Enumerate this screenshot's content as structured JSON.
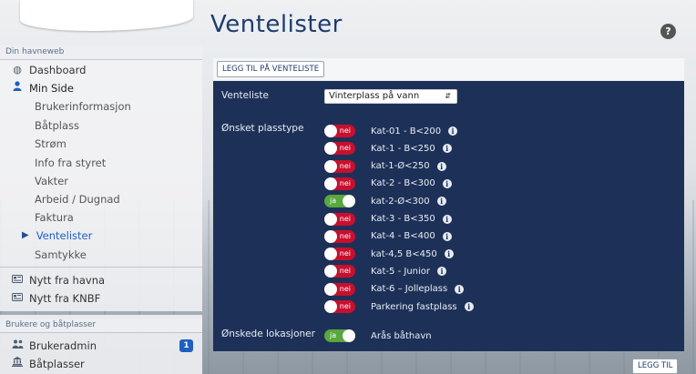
{
  "sidebar": {
    "section1_title": "Din havneweb",
    "items": [
      {
        "label": "Dashboard",
        "icon": "dashboard-icon"
      },
      {
        "label": "Min Side",
        "icon": "user-icon"
      },
      {
        "label": "Brukerinformasjon"
      },
      {
        "label": "Båtplass"
      },
      {
        "label": "Strøm"
      },
      {
        "label": "Info fra styret"
      },
      {
        "label": "Vakter"
      },
      {
        "label": "Arbeid / Dugnad"
      },
      {
        "label": "Faktura"
      },
      {
        "label": "Ventelister",
        "current": true
      },
      {
        "label": "Samtykke"
      },
      {
        "label": "Nytt fra havna",
        "icon": "newspaper-icon"
      },
      {
        "label": "Nytt fra KNBF",
        "icon": "newspaper-icon"
      }
    ],
    "section2_title": "Brukere og båtplasser",
    "items2": [
      {
        "label": "Brukeradmin",
        "icon": "users-icon",
        "badge": "1"
      },
      {
        "label": "Båtplasser",
        "icon": "harbor-icon"
      }
    ]
  },
  "main": {
    "title": "Ventelister",
    "add_button": "LEGG TIL PÅ VENTELISTE",
    "venteliste_label": "Venteliste",
    "venteliste_value": "Vinterplass på vann",
    "plasstype_label": "Ønsket plasstype",
    "plasstyper": [
      {
        "name": "Kat-01 - B<200",
        "state": "nei",
        "info": true
      },
      {
        "name": "Kat-1 - B<250",
        "state": "nei",
        "info": true
      },
      {
        "name": "kat-1-Ø<250",
        "state": "nei",
        "info": true
      },
      {
        "name": "Kat-2 - B<300",
        "state": "nei",
        "info": true
      },
      {
        "name": "kat-2-Ø<300",
        "state": "ja",
        "info": true
      },
      {
        "name": "Kat-3 - B<350",
        "state": "nei",
        "info": true
      },
      {
        "name": "Kat-4 - B<400",
        "state": "nei",
        "info": true
      },
      {
        "name": "kat-4,5 B<450",
        "state": "nei",
        "info": true
      },
      {
        "name": "Kat-5 - Junior",
        "state": "nei",
        "info": true
      },
      {
        "name": "Kat-6 – Jolleplass",
        "state": "nei",
        "info": true
      },
      {
        "name": "Parkering fastplass",
        "state": "nei",
        "info": true
      }
    ],
    "lokasjoner_label": "Ønskede lokasjoner",
    "lokasjoner": [
      {
        "name": "Arås båthavn",
        "state": "ja"
      }
    ],
    "bottom_button": "LEGG TIL",
    "info_glyph": "i",
    "help_glyph": "?"
  },
  "colors": {
    "panel": "#1d3158",
    "toggle_off": "#c8102e",
    "toggle_on": "#58a83d",
    "accent": "#1f5fbf",
    "title": "#1e3c6e"
  }
}
